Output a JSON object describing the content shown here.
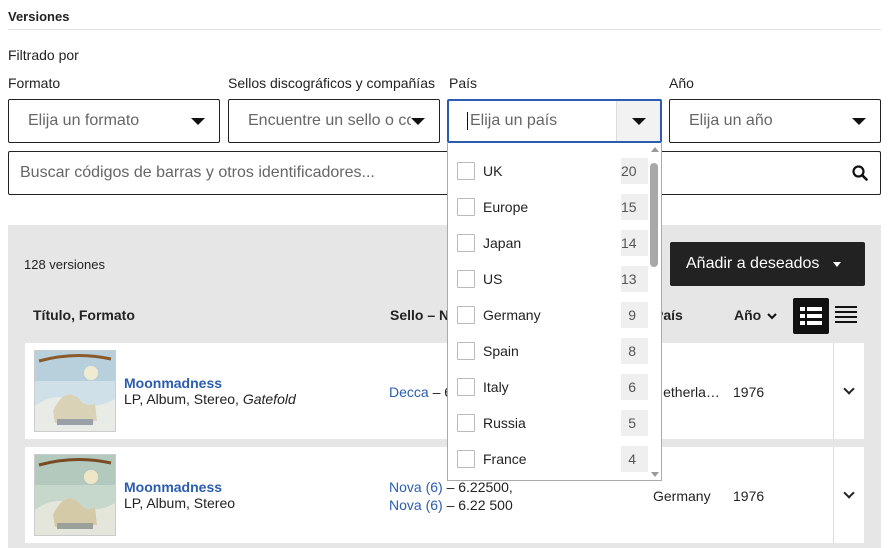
{
  "section": {
    "title": "Versiones",
    "filtered_by": "Filtrado por"
  },
  "filters": {
    "format": {
      "label": "Formato",
      "placeholder": "Elija un formato"
    },
    "label": {
      "label": "Sellos discográficos y compañías",
      "placeholder": "Encuentre un sello o compañía"
    },
    "country": {
      "label": "País",
      "placeholder": "Elija un país"
    },
    "year": {
      "label": "Año",
      "placeholder": "Elija un año"
    }
  },
  "search": {
    "placeholder": "Buscar códigos de barras y otros identificadores..."
  },
  "country_options": [
    {
      "name": "UK",
      "count": "20"
    },
    {
      "name": "Europe",
      "count": "15"
    },
    {
      "name": "Japan",
      "count": "14"
    },
    {
      "name": "US",
      "count": "13"
    },
    {
      "name": "Germany",
      "count": "9"
    },
    {
      "name": "Spain",
      "count": "8"
    },
    {
      "name": "Italy",
      "count": "6"
    },
    {
      "name": "Russia",
      "count": "5"
    },
    {
      "name": "France",
      "count": "4"
    }
  ],
  "versions": {
    "count_text": "128 versiones",
    "wishlist_button": "Añadir a deseados",
    "columns": {
      "title": "Título, Formato",
      "label": "Sello – N",
      "country": "País",
      "year": "Año"
    },
    "rows": [
      {
        "title": "Moonmadness",
        "format": "LP, Album, Stereo, ",
        "format_extra": "Gatefold",
        "label_link": "Decca",
        "label_rest": " – 6",
        "country": "Netherlands",
        "year": "1976"
      },
      {
        "title": "Moonmadness",
        "format": "LP, Album, Stereo",
        "label_link_1": "Nova (6)",
        "label_rest_1": " – 6.22500,",
        "label_link_2": "Nova (6)",
        "label_rest_2": " – 6.22 500",
        "country": "Germany",
        "year": "1976"
      }
    ]
  },
  "colors": {
    "link": "#2a5db0",
    "focus": "#2a5db0",
    "panel": "#e6e6e6",
    "button": "#222222"
  }
}
